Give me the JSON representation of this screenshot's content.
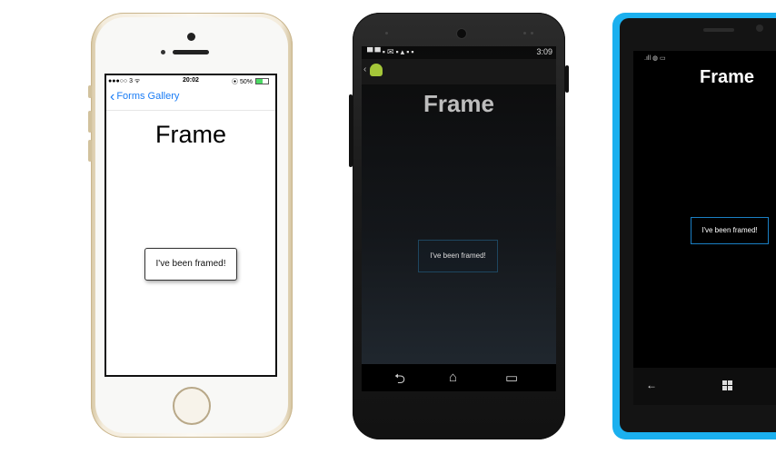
{
  "ios": {
    "status": {
      "carrier": "●●●○○ 3 ᯤ",
      "time": "20:02",
      "battery": "⦿ 50%"
    },
    "nav_back_label": "Forms Gallery",
    "title": "Frame",
    "frame_label": "I've been framed!"
  },
  "android": {
    "status": {
      "icons": "▀▀▪✉▪▴▪▪",
      "time": "3:09"
    },
    "title": "Frame",
    "frame_label": "I've been framed!"
  },
  "windows_phone": {
    "status_icons": ".ıll ◍ ▭",
    "title": "Frame",
    "frame_label": "I've been framed!"
  },
  "colors": {
    "ios_accent": "#1a7cf5",
    "android_frame_border": "#1e4660",
    "wp_frame_border": "#1a7fc4",
    "wp_device": "#1bb0ef"
  }
}
